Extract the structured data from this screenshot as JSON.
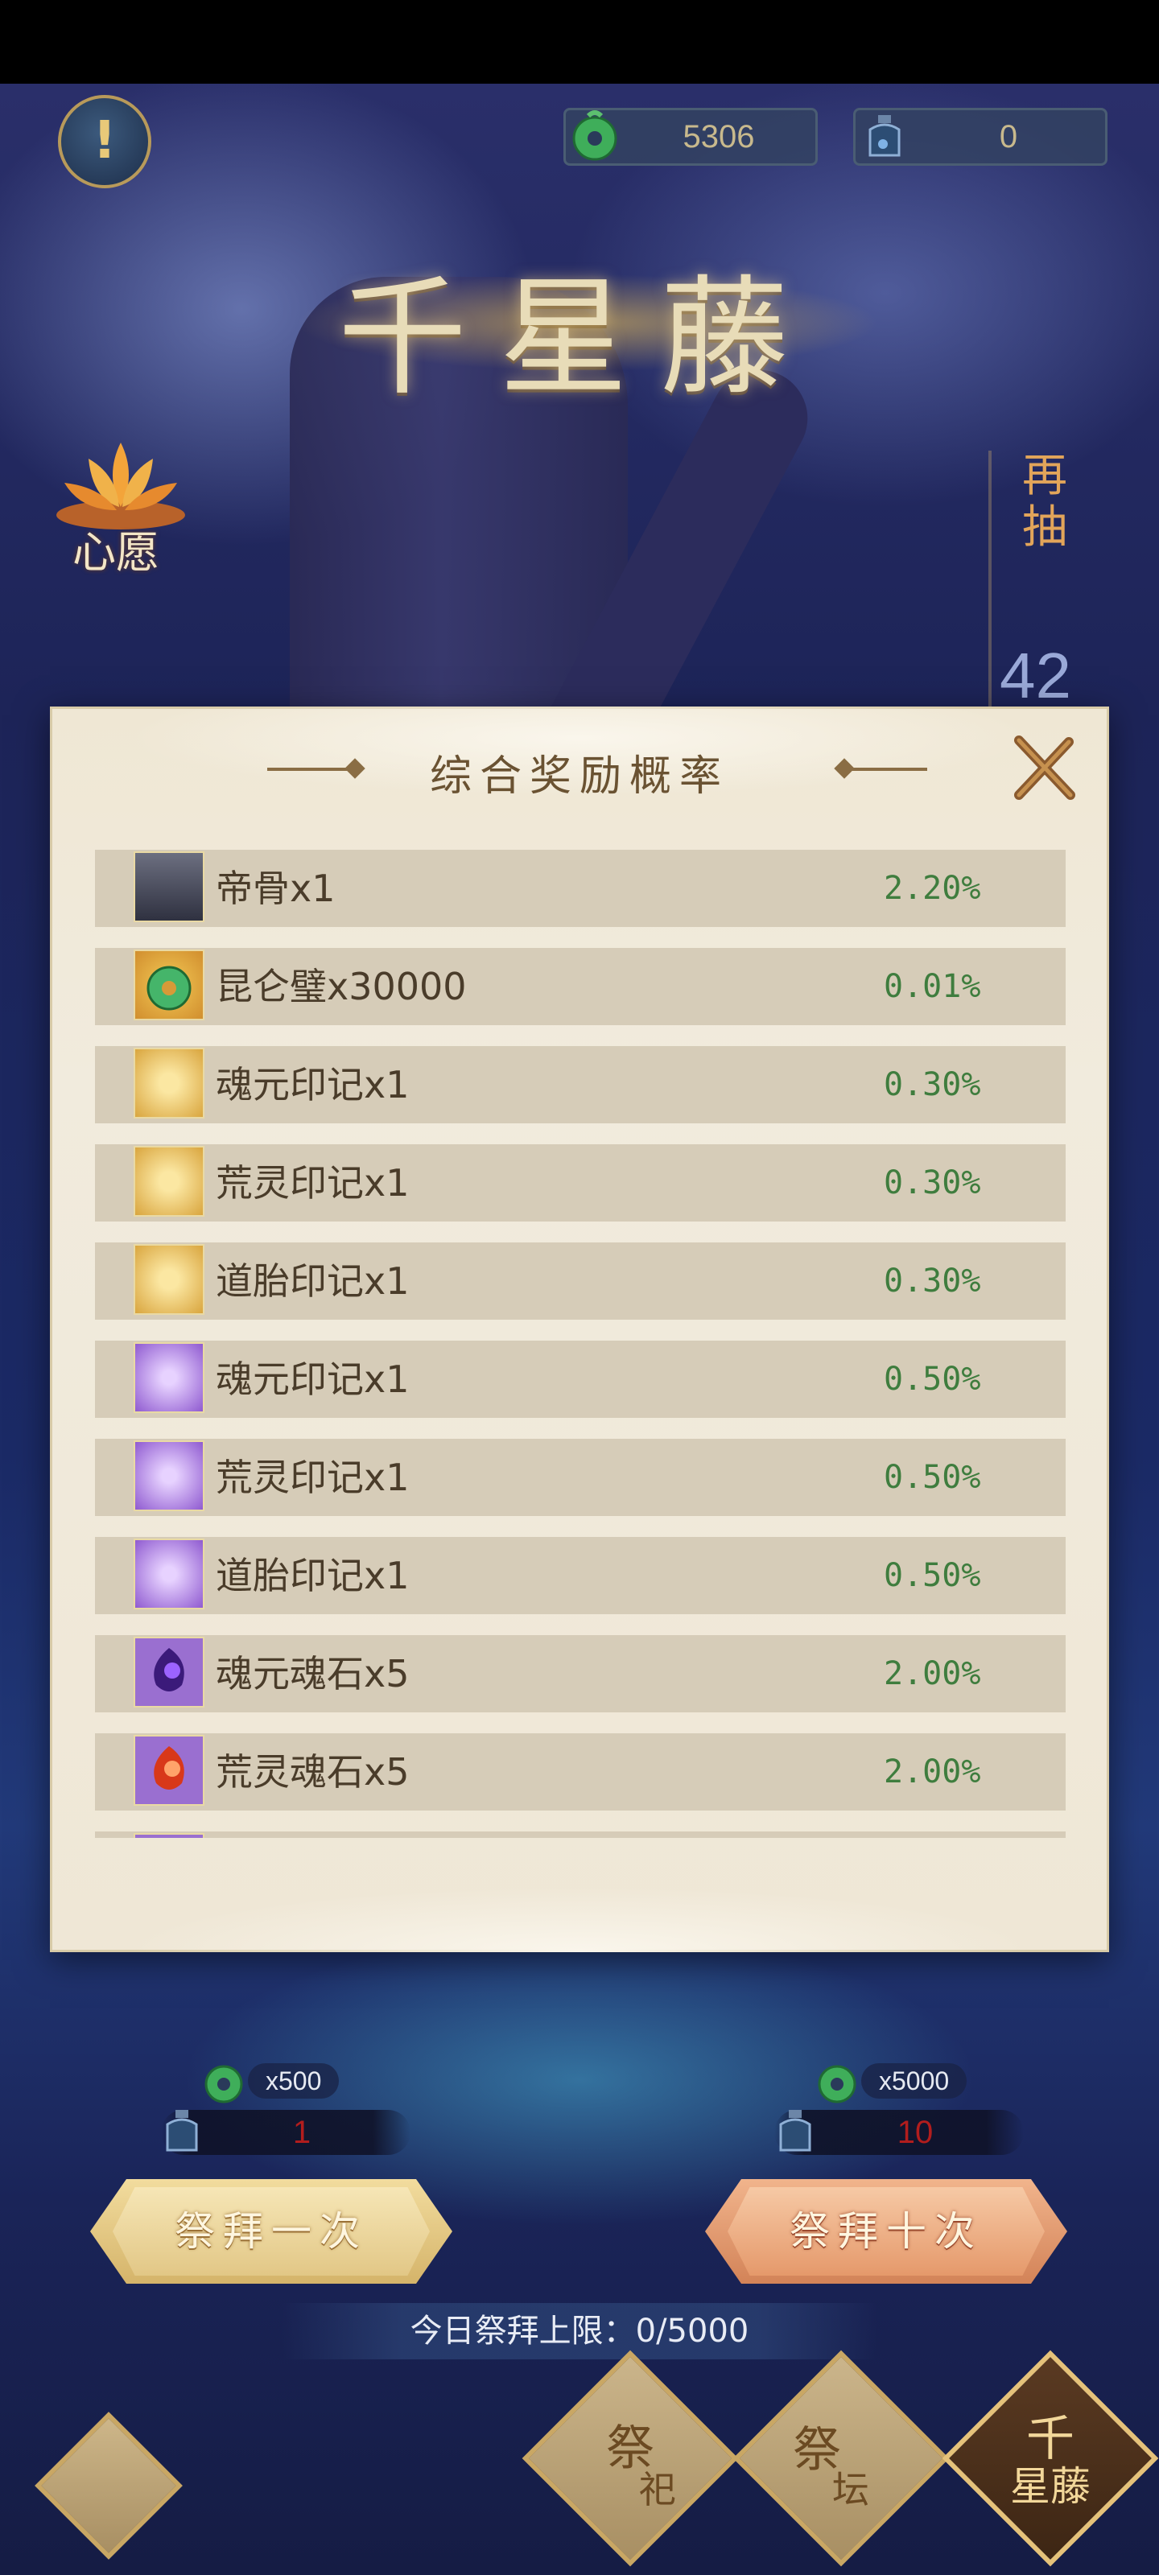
{
  "currency": [
    {
      "icon": "jade-disc-icon",
      "value": "5306"
    },
    {
      "icon": "ink-bottle-icon",
      "value": "0"
    }
  ],
  "title": "千星藤",
  "wish": {
    "label": "心愿",
    "icon": "lotus-icon"
  },
  "draw_again": {
    "label": "再抽",
    "count": "42"
  },
  "modal": {
    "title": "综合奖励概率",
    "items": [
      {
        "icon": "character-portrait-icon",
        "name": "帝骨x1",
        "rate": "2.20%"
      },
      {
        "icon": "jade-disc-icon",
        "name": "昆仑璧x30000",
        "rate": "0.01%"
      },
      {
        "icon": "gold-seal-feather-icon",
        "name": "魂元印记x1",
        "rate": "0.30%"
      },
      {
        "icon": "gold-seal-feather-icon",
        "name": "荒灵印记x1",
        "rate": "0.30%"
      },
      {
        "icon": "gold-seal-feather-icon",
        "name": "道胎印记x1",
        "rate": "0.30%"
      },
      {
        "icon": "purple-seal-feather-icon",
        "name": "魂元印记x1",
        "rate": "0.50%"
      },
      {
        "icon": "purple-seal-feather-icon",
        "name": "荒灵印记x1",
        "rate": "0.50%"
      },
      {
        "icon": "purple-seal-feather-icon",
        "name": "道胎印记x1",
        "rate": "0.50%"
      },
      {
        "icon": "purple-soul-stone-icon",
        "name": "魂元魂石x5",
        "rate": "2.00%"
      },
      {
        "icon": "red-soul-stone-icon",
        "name": "荒灵魂石x5",
        "rate": "2.00%"
      }
    ]
  },
  "pray_one": {
    "cost": "x500",
    "ink_cost": "1",
    "label": "祭拜一次"
  },
  "pray_ten": {
    "cost": "x5000",
    "ink_cost": "10",
    "label": "祭拜十次"
  },
  "daily_limit": "今日祭拜上限：0/5000",
  "tabs": [
    {
      "label_1": "祭",
      "label_2": "祀"
    },
    {
      "label_1": "祭",
      "label_2": "坛"
    },
    {
      "label_1": "千",
      "label_2": "星藤",
      "active": true
    }
  ],
  "colors": {
    "rate_text": "#3f7d3e",
    "ink_count": "#b21d1d",
    "accent_gold": "#c9a764"
  }
}
